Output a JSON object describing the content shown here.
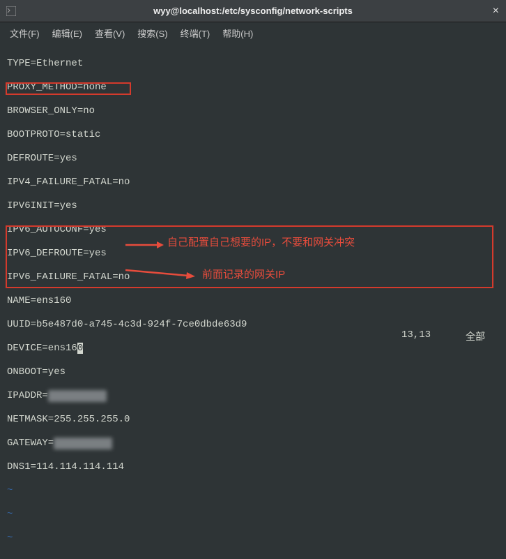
{
  "titlebar": {
    "title": "wyy@localhost:/etc/sysconfig/network-scripts",
    "close": "×"
  },
  "menubar": {
    "file": "文件(F)",
    "edit": "编辑(E)",
    "view": "查看(V)",
    "search": "搜索(S)",
    "terminal": "终端(T)",
    "help": "帮助(H)"
  },
  "config": {
    "l1": "TYPE=Ethernet",
    "l2": "PROXY_METHOD=none",
    "l3": "BROWSER_ONLY=no",
    "l4": "BOOTPROTO=static",
    "l5": "DEFROUTE=yes",
    "l6": "IPV4_FAILURE_FATAL=no",
    "l7": "IPV6INIT=yes",
    "l8": "IPV6_AUTOCONF=yes",
    "l9": "IPV6_DEFROUTE=yes",
    "l10": "IPV6_FAILURE_FATAL=no",
    "l11": "NAME=ens160",
    "l12": "UUID=b5e487d0-a745-4c3d-924f-7ce0dbde63d9",
    "l13_pre": "DEVICE=ens16",
    "l13_cur": "0",
    "l14": "ONBOOT=yes",
    "l15_pre": "IPADDR=",
    "l15_blur": "XXXXXXXXXX",
    "l16": "NETMASK=255.255.255.0",
    "l17_pre": "GATEWAY=",
    "l17_blur": "XXXXXXXXXX",
    "l18": "DNS1=114.114.114.114"
  },
  "tilde": "~",
  "annotations": {
    "a1": "自己配置自己想要的IP，不要和网关冲突",
    "a2": "前面记录的网关IP"
  },
  "status": {
    "pos": "13,13",
    "mode": "全部"
  }
}
